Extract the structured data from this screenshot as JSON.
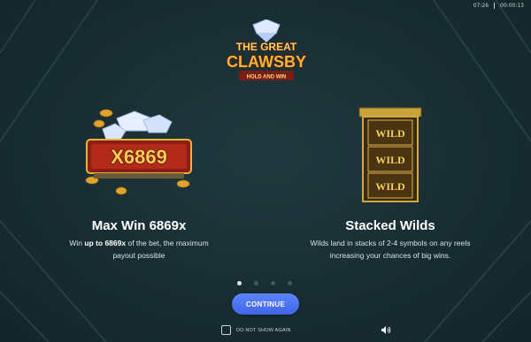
{
  "status": {
    "time": "07:26",
    "timer": "00:00:13"
  },
  "logo": {
    "line1": "THE GREAT",
    "line2": "CLAWSBY",
    "tagline": "HOLD AND WIN"
  },
  "features": [
    {
      "art_text": "X6869",
      "title": "Max Win 6869x",
      "desc_pre": "Win ",
      "desc_bold": "up to 6869x",
      "desc_line1_post": " of the bet, the maximum",
      "desc_line2": "payout possible"
    },
    {
      "art_labels": [
        "WILD",
        "WILD",
        "WILD"
      ],
      "title": "Stacked Wilds",
      "desc_line1": "Wilds land in stacks of 2-4 symbols on any reels",
      "desc_line2": "increasing your chances of big wins."
    }
  ],
  "pager": {
    "count": 4,
    "active_index": 0
  },
  "continue_label": "CONTINUE",
  "dont_show_label": "DO NOT SHOW AGAIN",
  "colors": {
    "accent": "#4a74f5",
    "gold": "#e9b23a",
    "background": "#182d32"
  }
}
